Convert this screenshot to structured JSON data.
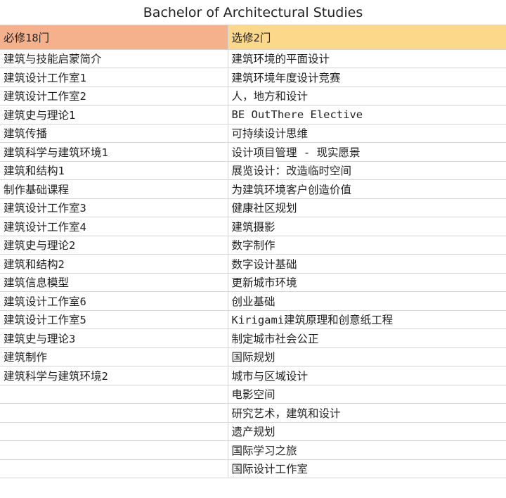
{
  "title": "Bachelor of Architectural Studies",
  "headers": {
    "required": "必修18门",
    "elective": "选修2门"
  },
  "colors": {
    "required_header_bg": "#f5b18b",
    "elective_header_bg": "#fcd88b",
    "grid_line": "#d4d4d4"
  },
  "rows": [
    {
      "required": "建筑与技能启蒙简介",
      "elective": "建筑环境的平面设计"
    },
    {
      "required": "建筑设计工作室1",
      "elective": "建筑环境年度设计竞赛"
    },
    {
      "required": "建筑设计工作室2",
      "elective": "人，地方和设计"
    },
    {
      "required": "建筑史与理论1",
      "elective": "BE OutThere Elective"
    },
    {
      "required": "建筑传播",
      "elective": "可持续设计思维"
    },
    {
      "required": "建筑科学与建筑环境1",
      "elective": "设计项目管理 - 现实愿景"
    },
    {
      "required": "建筑和结构1",
      "elective": "展览设计：改造临时空间"
    },
    {
      "required": "制作基础课程",
      "elective": "为建筑环境客户创造价值"
    },
    {
      "required": "建筑设计工作室3",
      "elective": "健康社区规划"
    },
    {
      "required": "建筑设计工作室4",
      "elective": "建筑摄影"
    },
    {
      "required": "建筑史与理论2",
      "elective": "数字制作"
    },
    {
      "required": "建筑和结构2",
      "elective": "数字设计基础"
    },
    {
      "required": "建筑信息模型",
      "elective": "更新城市环境"
    },
    {
      "required": "建筑设计工作室6",
      "elective": "创业基础"
    },
    {
      "required": "建筑设计工作室5",
      "elective": "Kirigami建筑原理和创意纸工程"
    },
    {
      "required": "建筑史与理论3",
      "elective": "制定城市社会公正"
    },
    {
      "required": "建筑制作",
      "elective": "国际规划"
    },
    {
      "required": "建筑科学与建筑环境2",
      "elective": "城市与区域设计"
    },
    {
      "required": "",
      "elective": "电影空间"
    },
    {
      "required": "",
      "elective": "研究艺术，建筑和设计"
    },
    {
      "required": "",
      "elective": "遗产规划"
    },
    {
      "required": "",
      "elective": "国际学习之旅"
    },
    {
      "required": "",
      "elective": "国际设计工作室"
    }
  ]
}
